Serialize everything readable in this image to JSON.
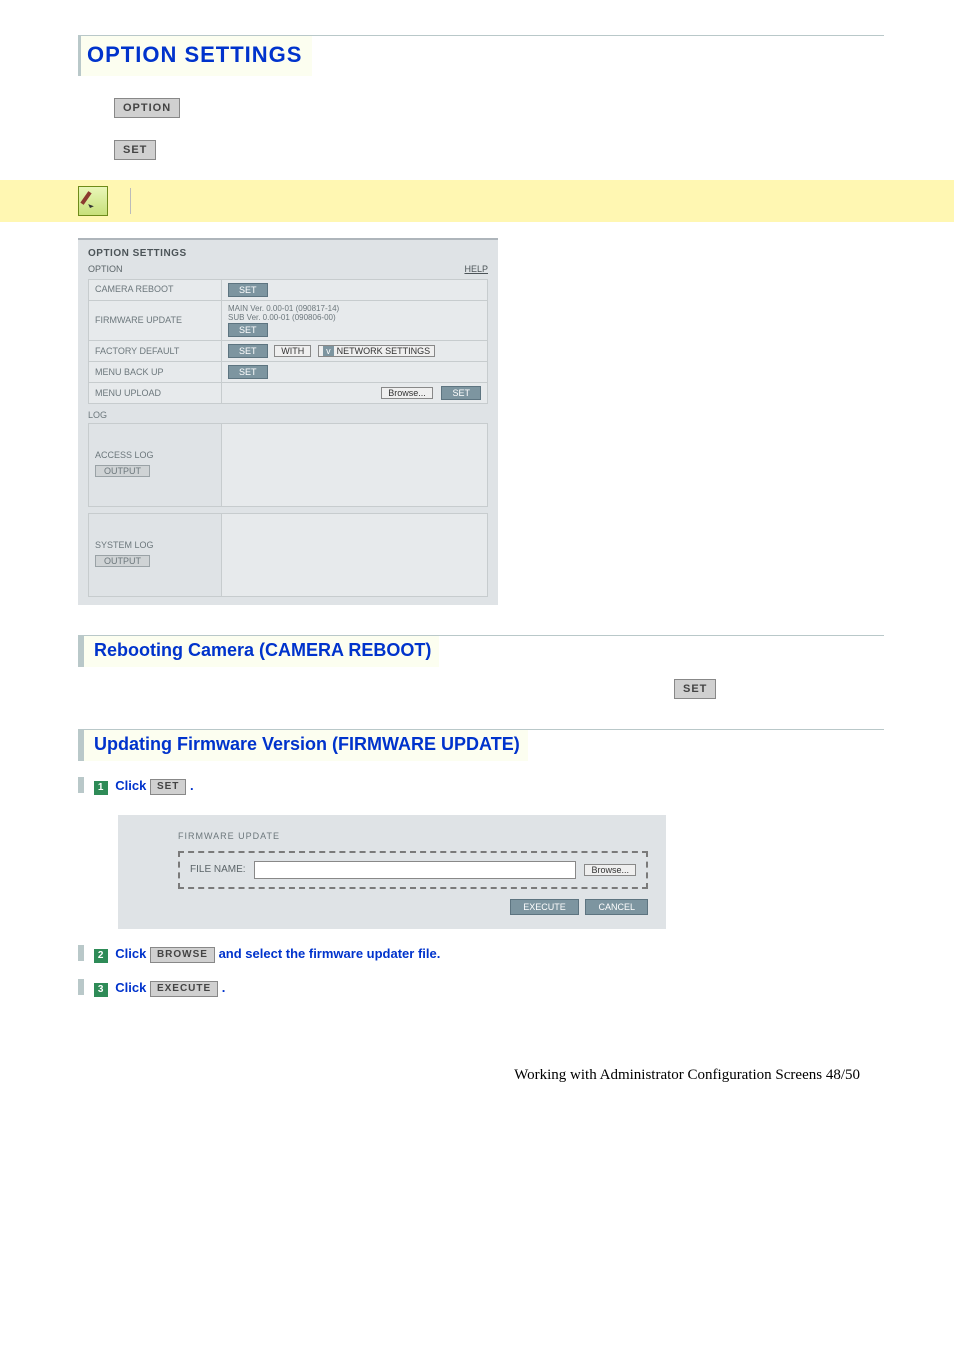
{
  "page_title": "OPTION SETTINGS",
  "labels": {
    "option": "OPTION",
    "set": "SET"
  },
  "panel": {
    "title": "OPTION SETTINGS",
    "section": "OPTION",
    "help": "HELP",
    "rows": {
      "camera_reboot": {
        "label": "CAMERA REBOOT",
        "btn": "SET"
      },
      "firmware_update": {
        "label": "FIRMWARE UPDATE",
        "main": "MAIN Ver. 0.00-01 (090817-14)",
        "sub": "SUB Ver. 0.00-01 (090806-00)",
        "btn": "SET"
      },
      "factory_default": {
        "label": "FACTORY DEFAULT",
        "btn": "SET",
        "with": "WITH",
        "drop": "NETWORK SETTINGS"
      },
      "menu_backup": {
        "label": "MENU BACK UP",
        "btn": "SET"
      },
      "menu_upload": {
        "label": "MENU UPLOAD",
        "browse": "Browse...",
        "btn": "SET"
      }
    },
    "log": {
      "section": "LOG",
      "access": {
        "label": "ACCESS LOG",
        "btn": "OUTPUT"
      },
      "system": {
        "label": "SYSTEM LOG",
        "btn": "OUTPUT"
      }
    }
  },
  "sections": {
    "reboot": "Rebooting Camera (CAMERA REBOOT)",
    "firmware": "Updating Firmware Version (FIRMWARE UPDATE)"
  },
  "steps": {
    "s1": {
      "n": "1",
      "a": "Click ",
      "btn": "SET",
      "b": " ."
    },
    "s2": {
      "n": "2",
      "a": "Click ",
      "btn": "BROWSE",
      "b": "  and select the firmware updater file."
    },
    "s3": {
      "n": "3",
      "a": "Click ",
      "btn": "EXECUTE",
      "b": " ."
    }
  },
  "fwpanel": {
    "title": "FIRMWARE UPDATE",
    "file": "FILE NAME:",
    "browse": "Browse...",
    "execute": "EXECUTE",
    "cancel": "CANCEL"
  },
  "footer": "Working with Administrator Configuration Screens 48/50"
}
